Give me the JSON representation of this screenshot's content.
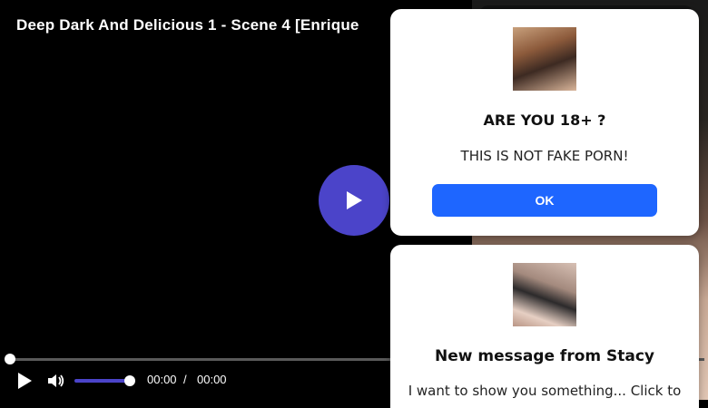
{
  "video": {
    "title": "Deep Dark And Delicious 1 - Scene 4 [Enrique"
  },
  "controls": {
    "current_time": "00:00",
    "separator": "/",
    "duration": "00:00",
    "volume_level": 0.9,
    "progress": 0,
    "accent_color": "#4b44c9"
  },
  "age_popup": {
    "title": "ARE YOU 18+ ?",
    "text": "THIS IS NOT FAKE PORN!",
    "ok_label": "OK",
    "button_color": "#1e66ff"
  },
  "message_popup": {
    "title": "New message from Stacy",
    "text": "I want to show you something... Click to"
  },
  "icons": {
    "big_play": "play-icon",
    "play": "play-icon",
    "volume": "volume-icon"
  }
}
